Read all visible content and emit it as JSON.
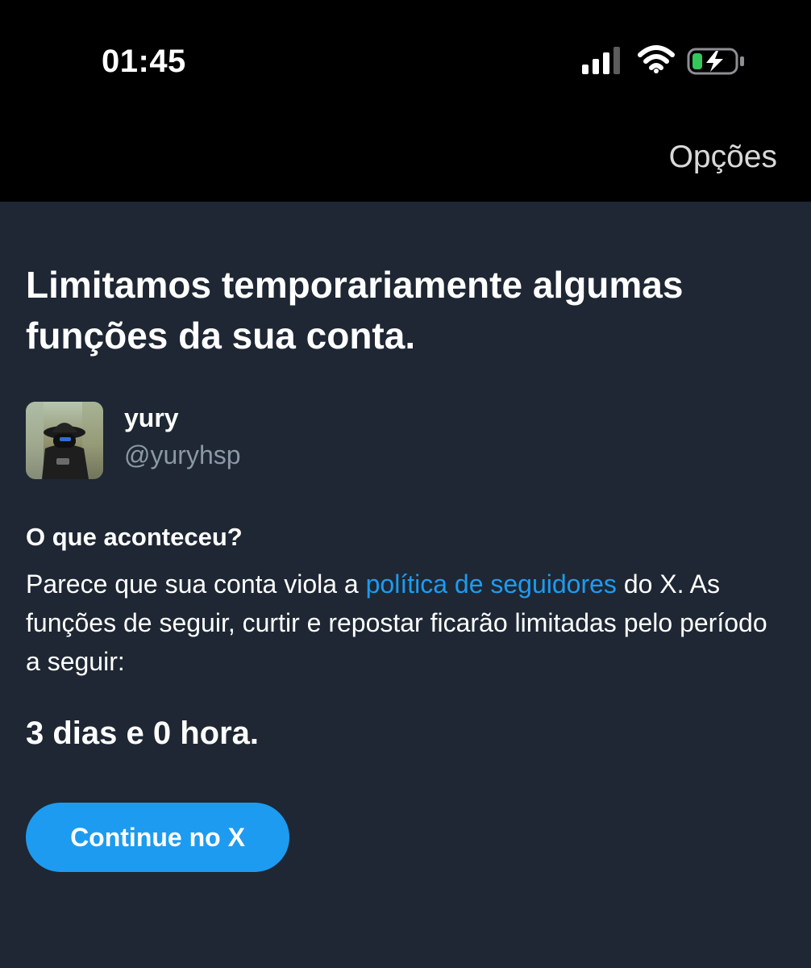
{
  "status_bar": {
    "time": "01:45",
    "signal_icon": "cellular-signal-icon",
    "wifi_icon": "wifi-icon",
    "battery_icon": "battery-charging-icon",
    "battery_color": "#34c759"
  },
  "header": {
    "options_label": "Opções"
  },
  "main": {
    "title": "Limitamos temporariamente algumas funções da sua conta.",
    "profile": {
      "name": "yury",
      "handle": "@yuryhsp",
      "avatar_icon": "profile-photo"
    },
    "section_title": "O que aconteceu?",
    "text_before_link": "Parece que sua conta viola a ",
    "link_text": "política de seguidores",
    "text_after_link": " do X. As funções de seguir, curtir e repostar ficarão limitadas pelo período a seguir:",
    "duration": "3 dias e 0 hora.",
    "continue_button": "Continue no X"
  },
  "colors": {
    "background": "#1e2733",
    "accent": "#1d9bf0",
    "secondary_text": "#8b98a5"
  }
}
